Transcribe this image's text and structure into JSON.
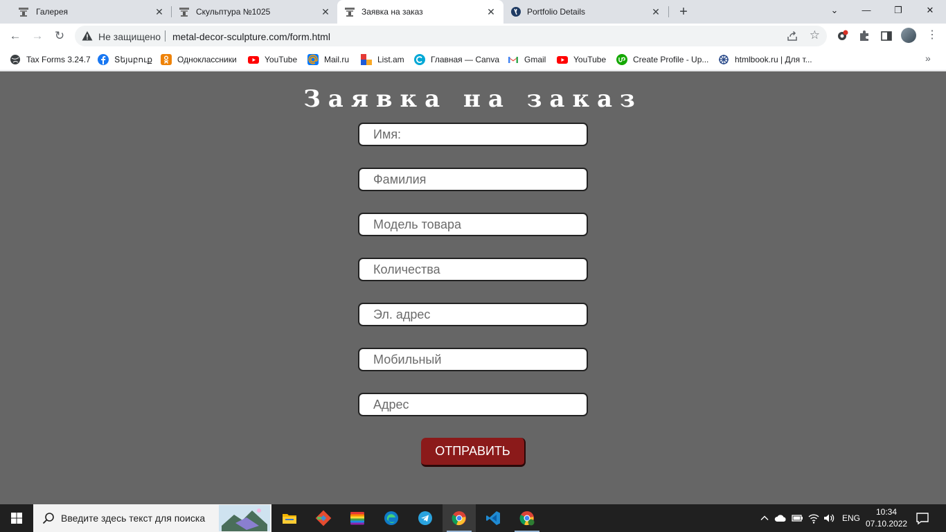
{
  "browser": {
    "tabs": [
      {
        "title": "Галерея",
        "icon": "sculpture-favicon"
      },
      {
        "title": "Скульптура №1025",
        "icon": "sculpture-favicon"
      },
      {
        "title": "Заявка на заказ",
        "icon": "sculpture-favicon",
        "active": true
      },
      {
        "title": "Portfolio Details",
        "icon": "wordpress-favicon"
      }
    ],
    "new_tab": "+",
    "window_controls": {
      "tab_search": "⌄",
      "minimize": "—",
      "restore": "❐",
      "close": "✕"
    },
    "address": {
      "security_label": "Не защищено",
      "url": "metal-decor-sculpture.com/form.html"
    },
    "bookmarks": [
      {
        "label": "Tax Forms 3.24.7",
        "icon": "globe-icon"
      },
      {
        "label": "Տեյսբուք",
        "icon": "facebook-icon"
      },
      {
        "label": "Одноклассники",
        "icon": "odnoklassniki-icon"
      },
      {
        "label": "YouTube",
        "icon": "youtube-icon"
      },
      {
        "label": "Mail.ru",
        "icon": "mailru-icon"
      },
      {
        "label": "List.am",
        "icon": "listam-icon"
      },
      {
        "label": "Главная — Canva",
        "icon": "canva-icon"
      },
      {
        "label": "Gmail",
        "icon": "gmail-icon"
      },
      {
        "label": "YouTube",
        "icon": "youtube-icon"
      },
      {
        "label": "Create Profile - Up...",
        "icon": "upwork-icon"
      },
      {
        "label": "htmlbook.ru | Для т...",
        "icon": "htmlbook-icon"
      }
    ],
    "bookmarks_more": "»"
  },
  "form": {
    "title": "Заявка на заказ",
    "fields": [
      {
        "placeholder": "Имя:"
      },
      {
        "placeholder": "Фамилия"
      },
      {
        "placeholder": "Модель товара"
      },
      {
        "placeholder": "Количества"
      },
      {
        "placeholder": "Эл. адрес"
      },
      {
        "placeholder": "Мобильный"
      },
      {
        "placeholder": "Адрес"
      }
    ],
    "submit_label": "ОТПРАВИТЬ",
    "colors": {
      "background": "#666666",
      "button": "#8b1a1a",
      "title": "#ffffff"
    }
  },
  "taskbar": {
    "search_placeholder": "Введите здесь текст для поиска",
    "apps": [
      "file-explorer-icon",
      "git-icon",
      "rainbow-app-icon",
      "edge-icon",
      "telegram-icon",
      "chrome-icon",
      "vscode-icon",
      "chrome-profile-icon"
    ],
    "language": "ENG",
    "time": "10:34",
    "date": "07.10.2022"
  }
}
